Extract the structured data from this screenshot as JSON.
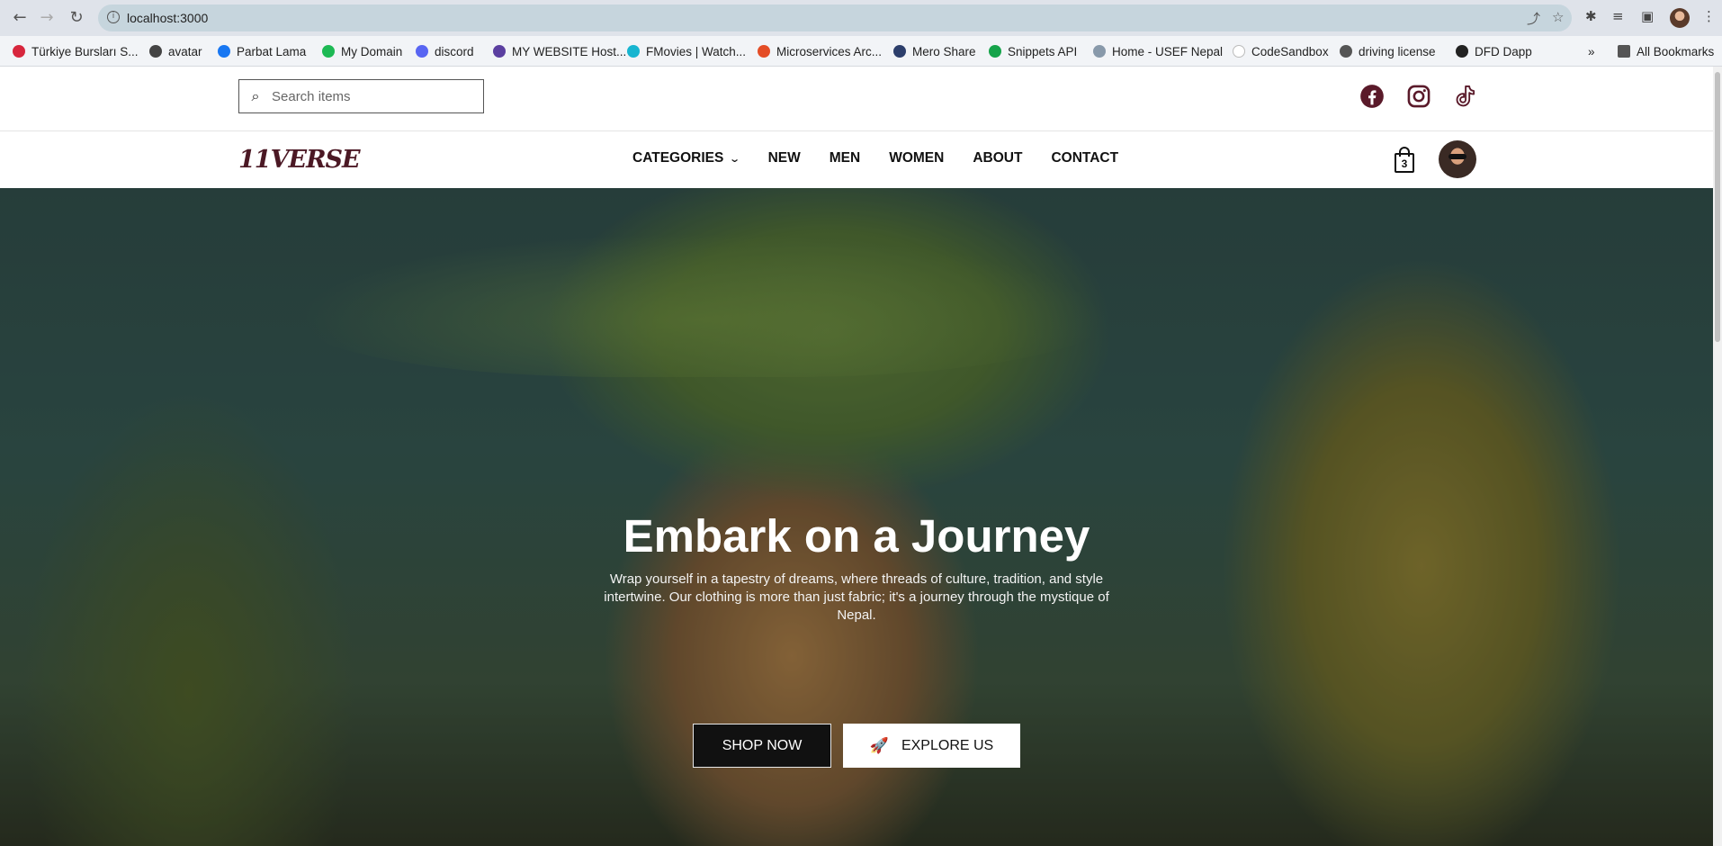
{
  "browser": {
    "url": "localhost:3000",
    "bookmarks": [
      {
        "label": "Türkiye Bursları S...",
        "color": "#d7263d"
      },
      {
        "label": "avatar",
        "color": "#444444"
      },
      {
        "label": "Parbat Lama",
        "color": "#1877f2"
      },
      {
        "label": "My Domain",
        "color": "#1db954"
      },
      {
        "label": "discord",
        "color": "#5865f2"
      },
      {
        "label": "MY WEBSITE Host...",
        "color": "#5b3fa0"
      },
      {
        "label": "FMovies | Watch...",
        "color": "#17b5d0"
      },
      {
        "label": "Microservices Arc...",
        "color": "#e44d26"
      },
      {
        "label": "Mero Share",
        "color": "#2c3e6b"
      },
      {
        "label": "Snippets API",
        "color": "#15a34a"
      },
      {
        "label": "Home - USEF Nepal",
        "color": "#8899aa"
      },
      {
        "label": "CodeSandbox",
        "color": "#ffffff"
      },
      {
        "label": "driving license",
        "color": "#555555"
      },
      {
        "label": "DFD Dapp",
        "color": "#222222"
      }
    ],
    "all_bookmarks": "All Bookmarks"
  },
  "site": {
    "search_placeholder": "Search items",
    "logo": "11VERSE",
    "menu": [
      "CATEGORIES",
      "NEW",
      "MEN",
      "WOMEN",
      "ABOUT",
      "CONTACT"
    ],
    "cart_count": "3",
    "social": [
      "facebook",
      "instagram",
      "tiktok"
    ],
    "brand_color": "#4b1824"
  },
  "hero": {
    "title": "Embark on a Journey",
    "text": "Wrap yourself in a tapestry of dreams, where threads of culture, tradition, and style intertwine. Our clothing is more than just fabric; it's a journey through the mystique of Nepal.",
    "shop_label": "SHOP NOW",
    "explore_label": "EXPLORE US"
  }
}
